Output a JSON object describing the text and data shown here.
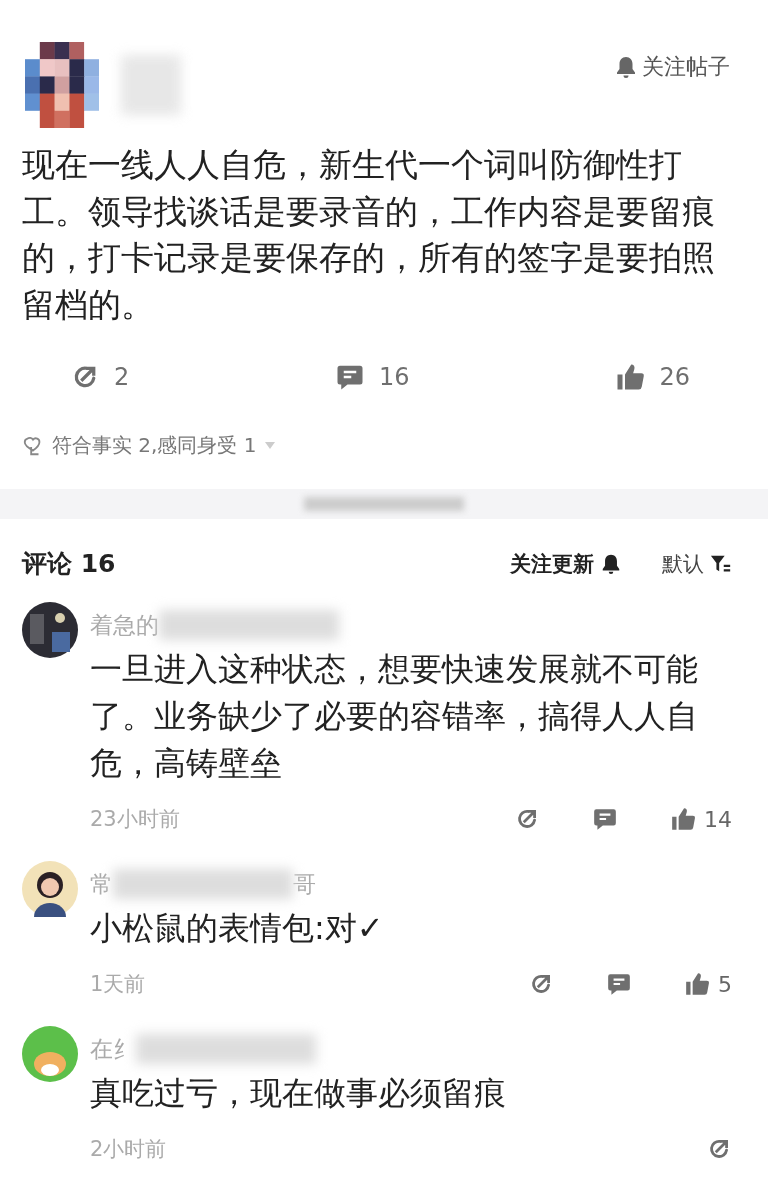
{
  "post": {
    "avatar": {
      "kind": "picture"
    },
    "follow_label": "关注帖子",
    "text": "现在一线人人自危，新生代一个词叫防御性打工。领导找谈话是要录音的，工作内容是要留痕的，打卡记录是要保存的，所有的签字是要拍照留档的。",
    "stats": [
      {
        "kind": "share",
        "count": "2"
      },
      {
        "kind": "comment",
        "count": "16"
      },
      {
        "kind": "like",
        "count": "26"
      }
    ],
    "reactions": "符合事实 2,感同身受 1"
  },
  "comments_header": {
    "title": "评论 16",
    "follow_label": "关注更新",
    "sort_label": "默认"
  },
  "comments": [
    {
      "avatar": {
        "kind": "picture"
      },
      "name_parts": [
        "着急的"
      ],
      "text": "一旦进入这种状态，想要快速发展就不可能了。业务缺少了必要的容错率，搞得人人自危，高铸壁垒",
      "time": "23小时前",
      "actions": [
        {
          "kind": "share"
        },
        {
          "kind": "comment"
        },
        {
          "kind": "like",
          "count": "14"
        }
      ]
    },
    {
      "avatar": {
        "kind": "picture"
      },
      "name_parts": [
        "常",
        "哥"
      ],
      "text": "小松鼠的表情包:对✓",
      "time": "1天前",
      "actions": [
        {
          "kind": "share"
        },
        {
          "kind": "comment"
        },
        {
          "kind": "like",
          "count": "5"
        }
      ]
    },
    {
      "avatar": {
        "kind": "picture"
      },
      "name_parts": [
        "在纟"
      ],
      "text": "真吃过亏，现在做事必须留痕",
      "time": "2小时前",
      "actions": [
        {
          "kind": "share"
        }
      ]
    }
  ]
}
